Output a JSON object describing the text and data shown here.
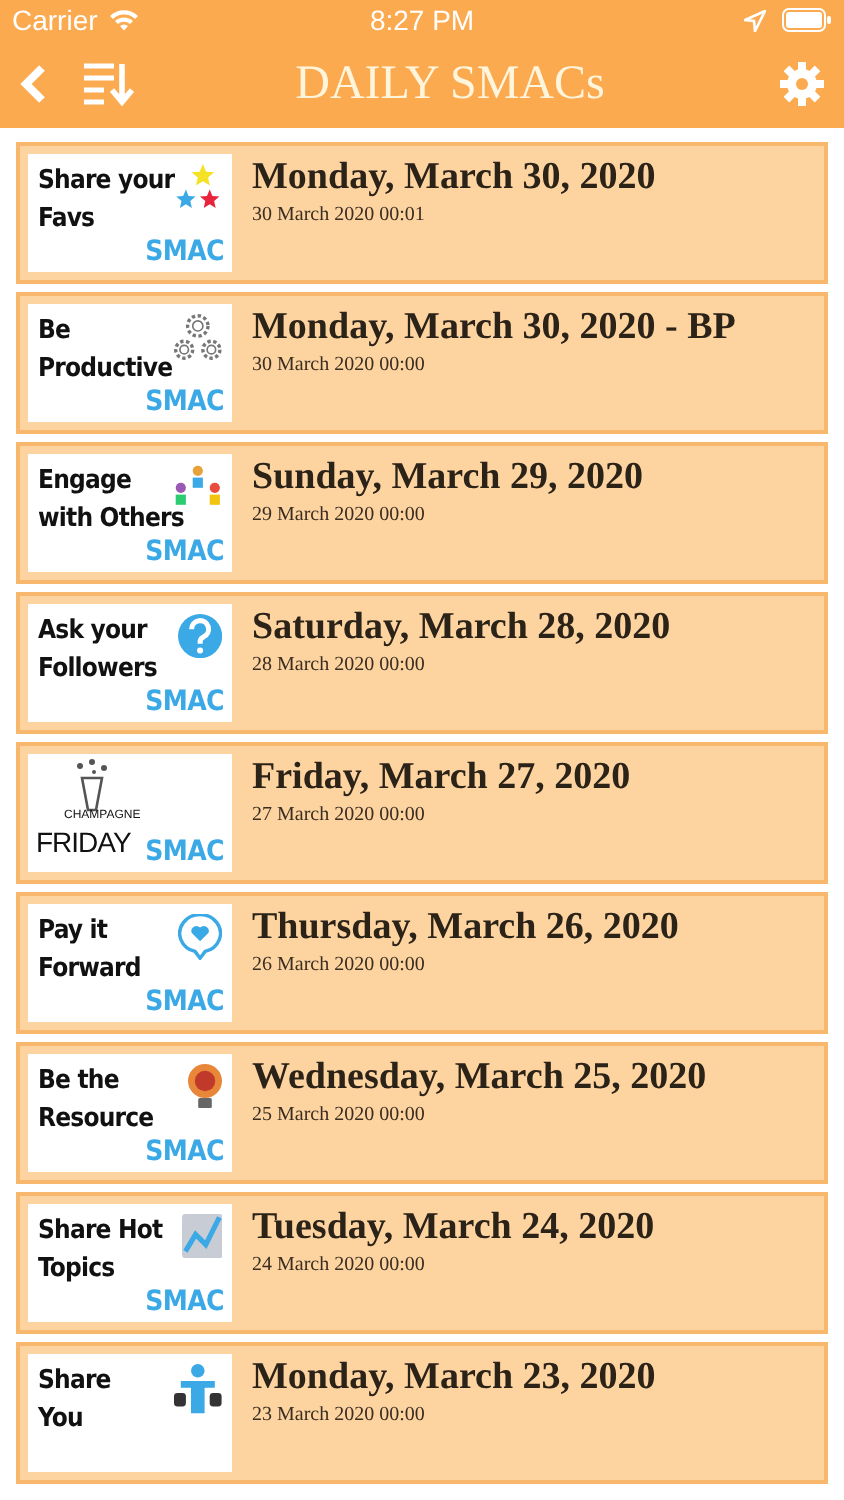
{
  "status_bar": {
    "carrier": "Carrier",
    "time": "8:27 PM"
  },
  "nav": {
    "title": "DAILY SMACs"
  },
  "items": [
    {
      "title": "Monday, March 30, 2020",
      "subtitle": "30 March 2020 00:01",
      "thumb": {
        "kind": "stars",
        "lines": [
          "Share your",
          "Favs"
        ],
        "brand": "SMAC"
      }
    },
    {
      "title": "Monday, March 30, 2020 - BP",
      "subtitle": "30 March 2020 00:00",
      "thumb": {
        "kind": "gears",
        "lines": [
          "Be",
          "Productive"
        ],
        "brand": "SMAC"
      }
    },
    {
      "title": "Sunday, March 29, 2020",
      "subtitle": "29 March 2020 00:00",
      "thumb": {
        "kind": "people",
        "lines": [
          "Engage",
          "with Others"
        ],
        "brand": "SMAC"
      }
    },
    {
      "title": "Saturday, March 28, 2020",
      "subtitle": "28 March 2020 00:00",
      "thumb": {
        "kind": "question",
        "lines": [
          "Ask your",
          "Followers"
        ],
        "brand": "SMAC"
      }
    },
    {
      "title": "Friday, March 27, 2020",
      "subtitle": "27 March 2020 00:00",
      "thumb": {
        "kind": "champagne",
        "lines": [
          "CHAMPAGNE",
          "FRIDAY"
        ],
        "brand": "SMAC"
      }
    },
    {
      "title": "Thursday, March 26, 2020",
      "subtitle": "26 March 2020 00:00",
      "thumb": {
        "kind": "heart",
        "lines": [
          "Pay it",
          "Forward"
        ],
        "brand": "SMAC"
      }
    },
    {
      "title": "Wednesday, March 25, 2020",
      "subtitle": "25 March 2020 00:00",
      "thumb": {
        "kind": "bulb",
        "lines": [
          "Be the",
          "Resource"
        ],
        "brand": "SMAC"
      }
    },
    {
      "title": "Tuesday, March 24, 2020",
      "subtitle": "24 March 2020 00:00",
      "thumb": {
        "kind": "chart",
        "lines": [
          "Share Hot",
          "Topics"
        ],
        "brand": "SMAC"
      }
    },
    {
      "title": "Monday, March 23, 2020",
      "subtitle": "23 March 2020 00:00",
      "thumb": {
        "kind": "person",
        "lines": [
          "Share",
          "You"
        ]
      }
    }
  ]
}
